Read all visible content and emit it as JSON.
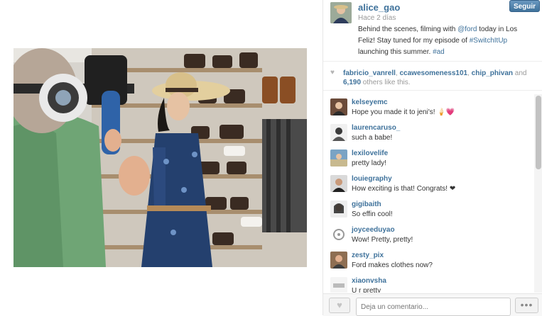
{
  "post": {
    "username": "alice_gao",
    "time_ago": "Hace 2 días",
    "follow_label": "Seguir",
    "caption": {
      "part1": "Behind the scenes, filming with ",
      "mention": "@ford",
      "part2": " today in Los Feliz! Stay tuned for my episode of ",
      "hashtag1": "#SwitchItUp",
      "part3": " launching this summer. ",
      "hashtag2": "#ad"
    }
  },
  "likes": {
    "user1": "fabricio_vanrell",
    "sep1": ", ",
    "user2": "ccawesomeness101",
    "sep2": ", ",
    "user3": "chip_phivan",
    "and": " and ",
    "count": "6,190",
    "others": " others like this."
  },
  "comments": [
    {
      "user": "kelseyemc",
      "text": "Hope you made it to jeni's! 🍦💗"
    },
    {
      "user": "laurencaruso_",
      "text": "such a babe!"
    },
    {
      "user": "lexilovelife",
      "text": "pretty lady!"
    },
    {
      "user": "louiegraphy",
      "text": "How exciting is that! Congrats! ❤"
    },
    {
      "user": "gigibaith",
      "text": "So effin cool!"
    },
    {
      "user": "joyceeduyao",
      "text": "Wow! Pretty, pretty!"
    },
    {
      "user": "zesty_pix",
      "text": "Ford makes clothes now?"
    },
    {
      "user": "xiaonvsha",
      "text": "U r pretty"
    }
  ],
  "footer": {
    "comment_placeholder": "Deja un comentario...",
    "more_label": "•••",
    "like_icon": "heart-icon"
  }
}
